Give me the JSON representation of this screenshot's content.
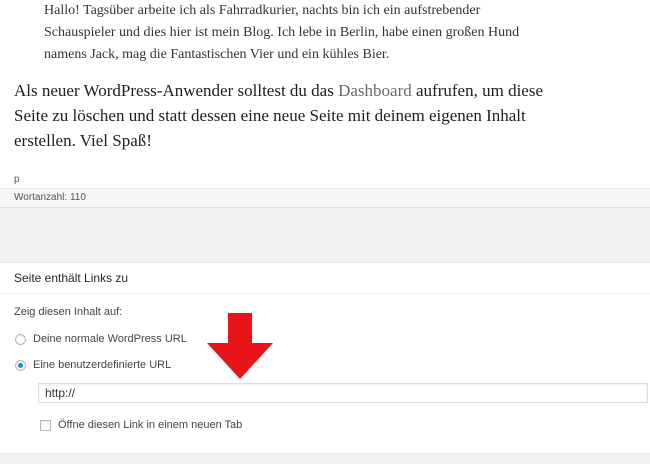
{
  "editor": {
    "quote_lines": [
      "Hallo! Tagsüber arbeite ich als Fahrradkurier, nachts bin ich ein aufstrebender",
      "Schauspieler und dies hier ist mein Blog. Ich lebe in Berlin, habe einen großen Hund",
      "namens Jack, mag die Fantastischen Vier und ein kühles Bier."
    ],
    "para_before": "Als neuer WordPress-Anwender solltest du das ",
    "para_link": "Dashboard",
    "para_after": " aufrufen, um diese Seite zu löschen und statt dessen eine neue Seite mit deinem eigenen Inhalt erstellen. Viel Spaß!",
    "path": "p",
    "word_count": "Wortanzahl: 110"
  },
  "metabox": {
    "title": "Seite enthält Links zu",
    "show_label": "Zeig diesen Inhalt auf:",
    "options": [
      {
        "label": "Deine normale WordPress URL",
        "selected": false
      },
      {
        "label": "Eine benutzerdefinierte URL",
        "selected": true
      }
    ],
    "url_value": "http://",
    "new_tab_label": "Öffne diesen Link in einem neuen Tab",
    "new_tab_checked": false
  },
  "colors": {
    "arrow": "#e8141a",
    "link": "#6a6a6a",
    "radio_selected": "#1e8cbe"
  },
  "icons": {
    "arrow": "down-arrow-icon"
  }
}
